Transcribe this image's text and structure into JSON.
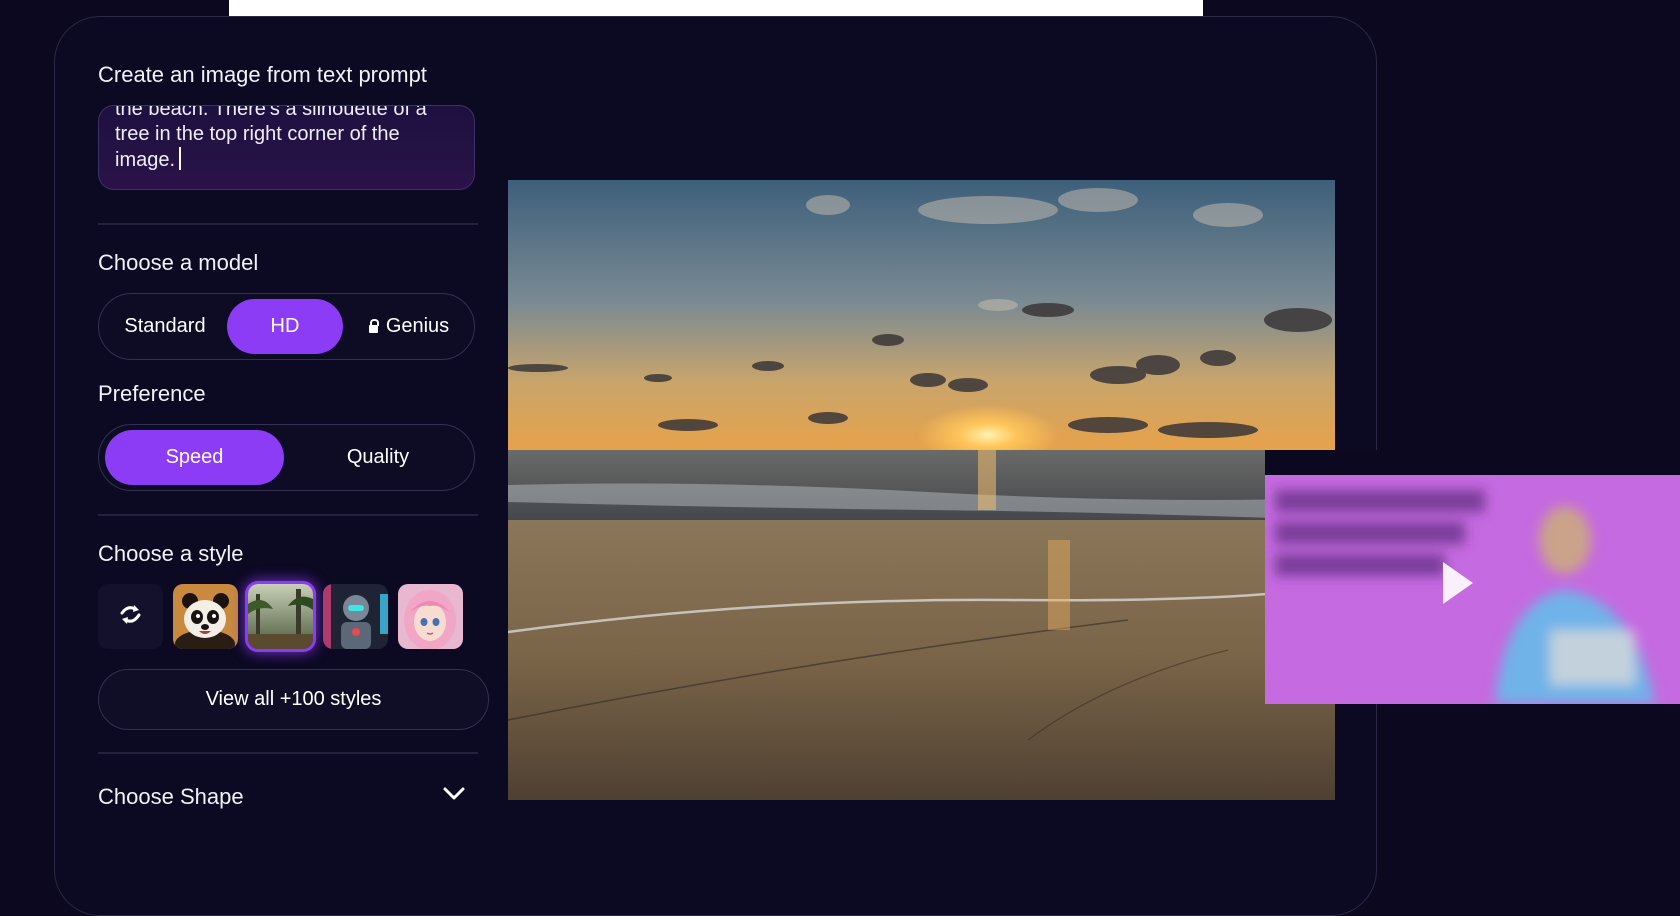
{
  "prompt": {
    "label": "Create an image from text prompt",
    "text": "the beach. There’s a silhouette of a tree in the top right corner of the image."
  },
  "model": {
    "label": "Choose a model",
    "options": [
      "Standard",
      "HD",
      "Genius"
    ],
    "selected": "HD",
    "locked_option_icon": "lock-icon"
  },
  "preference": {
    "label": "Preference",
    "options": [
      "Speed",
      "Quality"
    ],
    "selected": "Speed"
  },
  "style": {
    "label": "Choose a style",
    "thumbnails": [
      "no-style-icon",
      "panda",
      "jungle",
      "robot",
      "anime-girl"
    ],
    "selected_index": 2,
    "view_all_label": "View all +100 styles"
  },
  "shape": {
    "label": "Choose Shape",
    "expand_icon": "chevron-down-icon"
  },
  "colors": {
    "background": "#0b0820",
    "accent": "#8c3cf5",
    "overlay": "#c56ae0"
  }
}
